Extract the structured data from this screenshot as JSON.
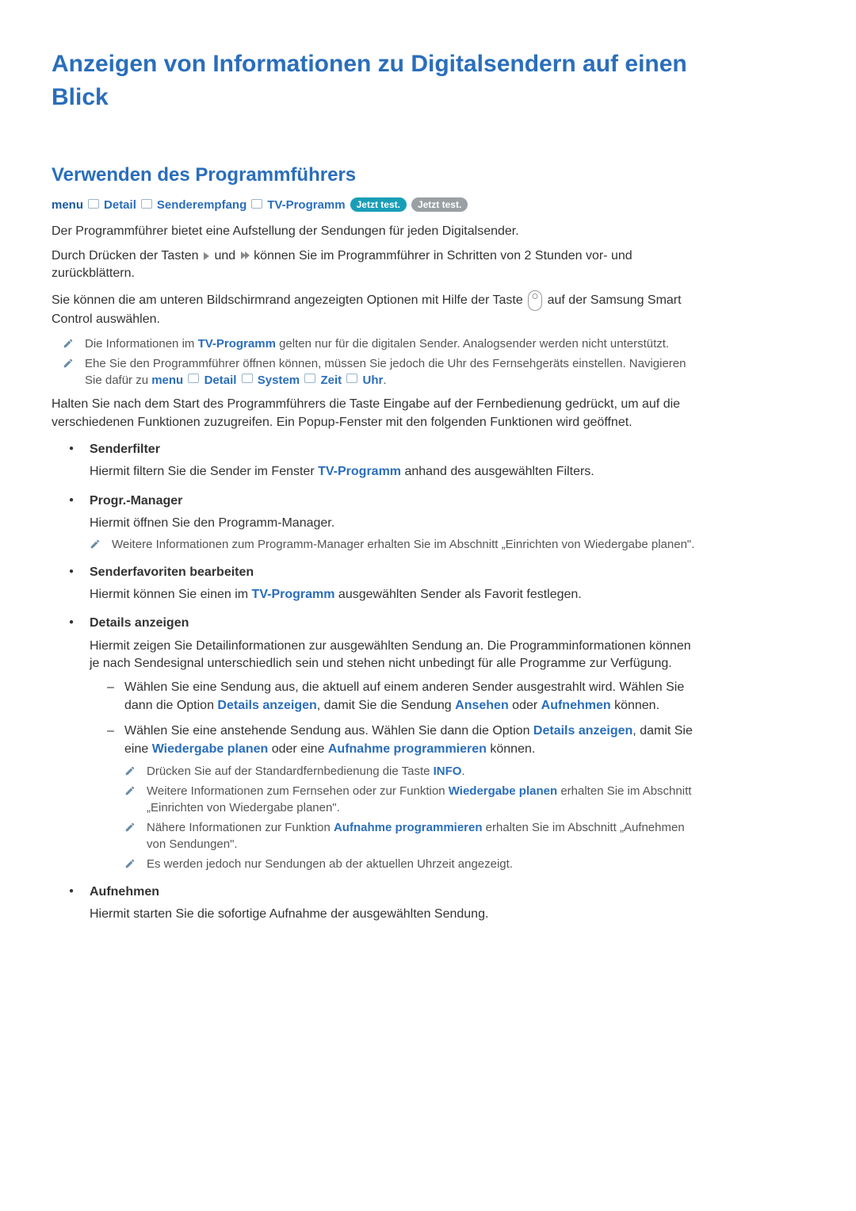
{
  "title": "Anzeigen von Informationen zu Digitalsendern auf einen Blick",
  "section": "Verwenden des Programmführers",
  "bc": {
    "menu": "menu",
    "detail": "Detail",
    "sender": "Senderempfang",
    "tv": "TV-Programm",
    "try1": "Jetzt test.",
    "try2": "Jetzt test."
  },
  "p1": "Der Programmführer bietet eine Aufstellung der Sendungen für jeden Digitalsender.",
  "p2a": "Durch Drücken der Tasten ",
  "p2b": " und ",
  "p2c": " können Sie im Programmführer in Schritten von 2 Stunden vor- und zurückblättern.",
  "p3a": "Sie können die am unteren Bildschirmrand angezeigten Optionen mit Hilfe der Taste ",
  "p3b": " auf der Samsung Smart Control auswählen.",
  "n1a": "Die Informationen im ",
  "n1b": "TV-Programm",
  "n1c": " gelten nur für die digitalen Sender. Analogsender werden nicht unterstützt.",
  "n2a": "Ehe Sie den Programmführer öffnen können, müssen Sie jedoch die Uhr des Fernsehgeräts einstellen. Navigieren Sie dafür zu ",
  "n2_menu": "menu",
  "n2_detail": "Detail",
  "n2_system": "System",
  "n2_zeit": "Zeit",
  "n2_uhr": "Uhr",
  "n2_end": ".",
  "p4": "Halten Sie nach dem Start des Programmführers die Taste Eingabe auf der Fernbedienung gedrückt, um auf die verschiedenen Funktionen zuzugreifen. Ein Popup-Fenster mit den folgenden Funktionen wird geöffnet.",
  "b1_t": "Senderfilter",
  "b1_p_a": "Hiermit filtern Sie die Sender im Fenster ",
  "b1_p_b": "TV-Programm",
  "b1_p_c": " anhand des ausgewählten Filters.",
  "b2_t": "Progr.-Manager",
  "b2_p": "Hiermit öffnen Sie den Programm-Manager.",
  "b2_n": "Weitere Informationen zum Programm-Manager erhalten Sie im Abschnitt „Einrichten von Wiedergabe planen\".",
  "b3_t": "Senderfavoriten bearbeiten",
  "b3_p_a": "Hiermit können Sie einen im ",
  "b3_p_b": "TV-Programm",
  "b3_p_c": " ausgewählten Sender als Favorit festlegen.",
  "b4_t": "Details anzeigen",
  "b4_p": "Hiermit zeigen Sie Detailinformationen zur ausgewählten Sendung an. Die Programminformationen können je nach Sendesignal unterschiedlich sein und stehen nicht unbedingt für alle Programme zur Verfügung.",
  "d1_a": "Wählen Sie eine Sendung aus, die aktuell auf einem anderen Sender ausgestrahlt wird. Wählen Sie dann die Option ",
  "d1_b": "Details anzeigen",
  "d1_c": ", damit Sie die Sendung ",
  "d1_d": "Ansehen",
  "d1_e": " oder ",
  "d1_f": "Aufnehmen",
  "d1_g": " können.",
  "d2_a": "Wählen Sie eine anstehende Sendung aus. Wählen Sie dann die Option ",
  "d2_b": "Details anzeigen",
  "d2_c": ", damit Sie eine ",
  "d2_d": "Wiedergabe planen",
  "d2_e": " oder eine ",
  "d2_f": "Aufnahme programmieren",
  "d2_g": " können.",
  "nn1_a": "Drücken Sie auf der Standardfernbedienung die Taste ",
  "nn1_b": "INFO",
  "nn1_c": ".",
  "nn2_a": "Weitere Informationen zum Fernsehen oder zur Funktion ",
  "nn2_b": "Wiedergabe planen",
  "nn2_c": " erhalten Sie im Abschnitt „Einrichten von Wiedergabe planen\".",
  "nn3_a": "Nähere Informationen zur Funktion ",
  "nn3_b": "Aufnahme programmieren",
  "nn3_c": " erhalten Sie im Abschnitt „Aufnehmen von Sendungen\".",
  "nn4": "Es werden jedoch nur Sendungen ab der aktuellen Uhrzeit angezeigt.",
  "b5_t": "Aufnehmen",
  "b5_p": "Hiermit starten Sie die sofortige Aufnahme der ausgewählten Sendung."
}
